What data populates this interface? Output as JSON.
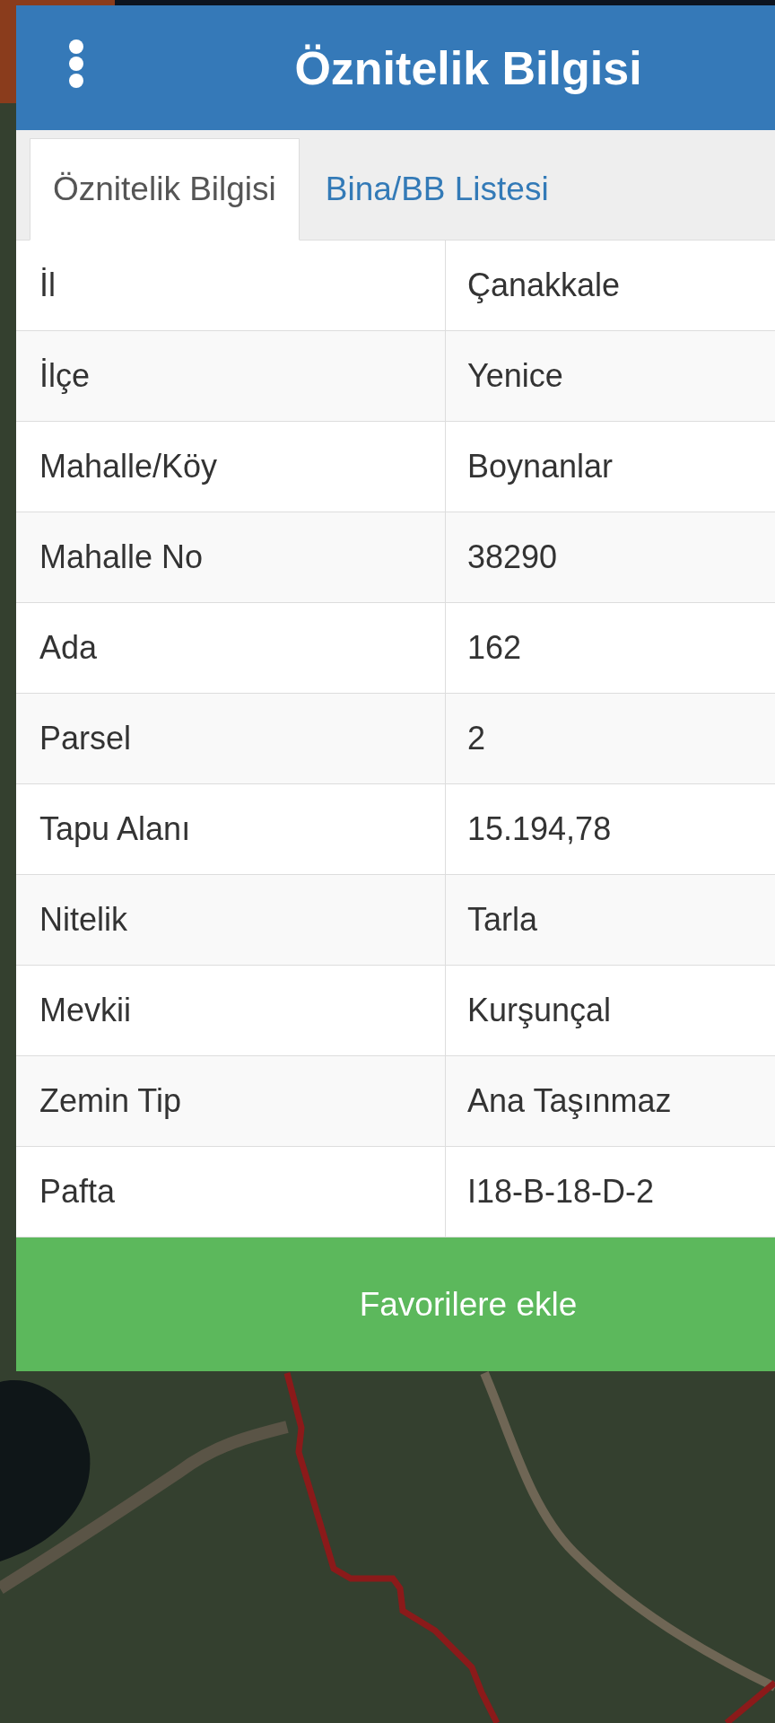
{
  "header": {
    "title": "Öznitelik Bilgisi"
  },
  "tabs": [
    {
      "label": "Öznitelik Bilgisi",
      "selected": true
    },
    {
      "label": "Bina/BB Listesi",
      "selected": false
    }
  ],
  "table": {
    "rows": [
      {
        "label": "İl",
        "value": "Çanakkale"
      },
      {
        "label": "İlçe",
        "value": "Yenice"
      },
      {
        "label": "Mahalle/Köy",
        "value": "Boynanlar"
      },
      {
        "label": "Mahalle No",
        "value": "38290"
      },
      {
        "label": "Ada",
        "value": "162"
      },
      {
        "label": "Parsel",
        "value": "2"
      },
      {
        "label": "Tapu Alanı",
        "value": "15.194,78"
      },
      {
        "label": "Nitelik",
        "value": "Tarla"
      },
      {
        "label": "Mevkii",
        "value": "Kurşunçal"
      },
      {
        "label": "Zemin Tip",
        "value": "Ana Taşınmaz"
      },
      {
        "label": "Pafta",
        "value": "I18-B-18-D-2"
      }
    ]
  },
  "favorite_button": {
    "label": "Favorilere ekle"
  }
}
